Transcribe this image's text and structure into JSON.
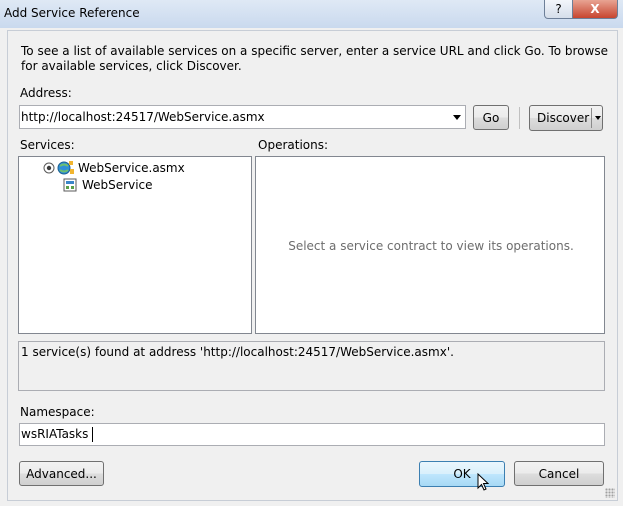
{
  "window": {
    "title": "Add Service Reference",
    "help_label": "?",
    "close_label": "X"
  },
  "description": "To see a list of available services on a specific server, enter a service URL and click Go. To browse for available services, click Discover.",
  "address": {
    "label": "Address:",
    "value": "http://localhost:24517/WebService.asmx",
    "go_label": "Go",
    "discover_label": "Discover"
  },
  "services": {
    "label": "Services:",
    "items": [
      {
        "label": "WebService.asmx",
        "icon": "globe-service-icon",
        "level": 0
      },
      {
        "label": "WebService",
        "icon": "service-contract-icon",
        "level": 1
      }
    ]
  },
  "operations": {
    "label": "Operations:",
    "empty_message": "Select a service contract to view its operations."
  },
  "status_message": "1 service(s) found at address 'http://localhost:24517/WebService.asmx'.",
  "namespace": {
    "label": "Namespace:",
    "value": "wsRIATasks"
  },
  "buttons": {
    "advanced_label": "Advanced...",
    "ok_label": "OK",
    "cancel_label": "Cancel"
  },
  "colors": {
    "accent": "#3c7fb1",
    "window_bg": "#f0f0f0"
  }
}
